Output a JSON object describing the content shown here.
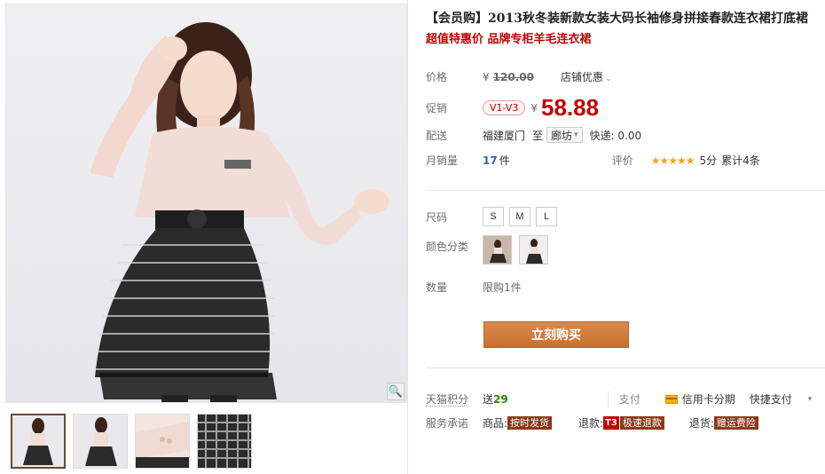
{
  "product": {
    "title": "【会员购】2013秋冬装新款女装大码长袖修身拼接春款连衣裙打底裙",
    "subtitle": "超值特惠价 品牌专柜羊毛连衣裙"
  },
  "price": {
    "label": "价格",
    "currency": "¥",
    "original": "120.00",
    "coupon_link": "店铺优惠"
  },
  "promo": {
    "label": "促销",
    "vip_tag": "V1-V3",
    "currency": "¥",
    "price": "58.88"
  },
  "shipping": {
    "label": "配送",
    "from": "福建厦门",
    "to_word": "至",
    "destination": "廊坊",
    "express": "快递: 0.00"
  },
  "sales": {
    "label": "月销量",
    "count": "17",
    "unit": "件",
    "rating_label": "评价",
    "stars": "★★★★★",
    "score": "5分",
    "reviews": "累计4条"
  },
  "size": {
    "label": "尺码",
    "options": [
      "S",
      "M",
      "L"
    ]
  },
  "color": {
    "label": "颜色分类"
  },
  "quantity": {
    "label": "数量",
    "limit": "限购1件"
  },
  "buy_button": "立刻购买",
  "points": {
    "label": "天猫积分",
    "prefix": "送",
    "value": "29"
  },
  "payment": {
    "label": "支付",
    "credit": "信用卡分期",
    "quick": "快捷支付"
  },
  "service": {
    "label": "服务承诺",
    "goods_label": "商品:",
    "goods_tag": "按时发货",
    "refund_label": "退款:",
    "refund_t3": "T3",
    "refund_tag": "极速退款",
    "return_label": "退货:",
    "return_tag": "赠运费险"
  },
  "colors": {
    "price_red": "#c40000",
    "buy_button": "#c9702f",
    "star": "#f7a21b",
    "points_green": "#2b8a00"
  }
}
